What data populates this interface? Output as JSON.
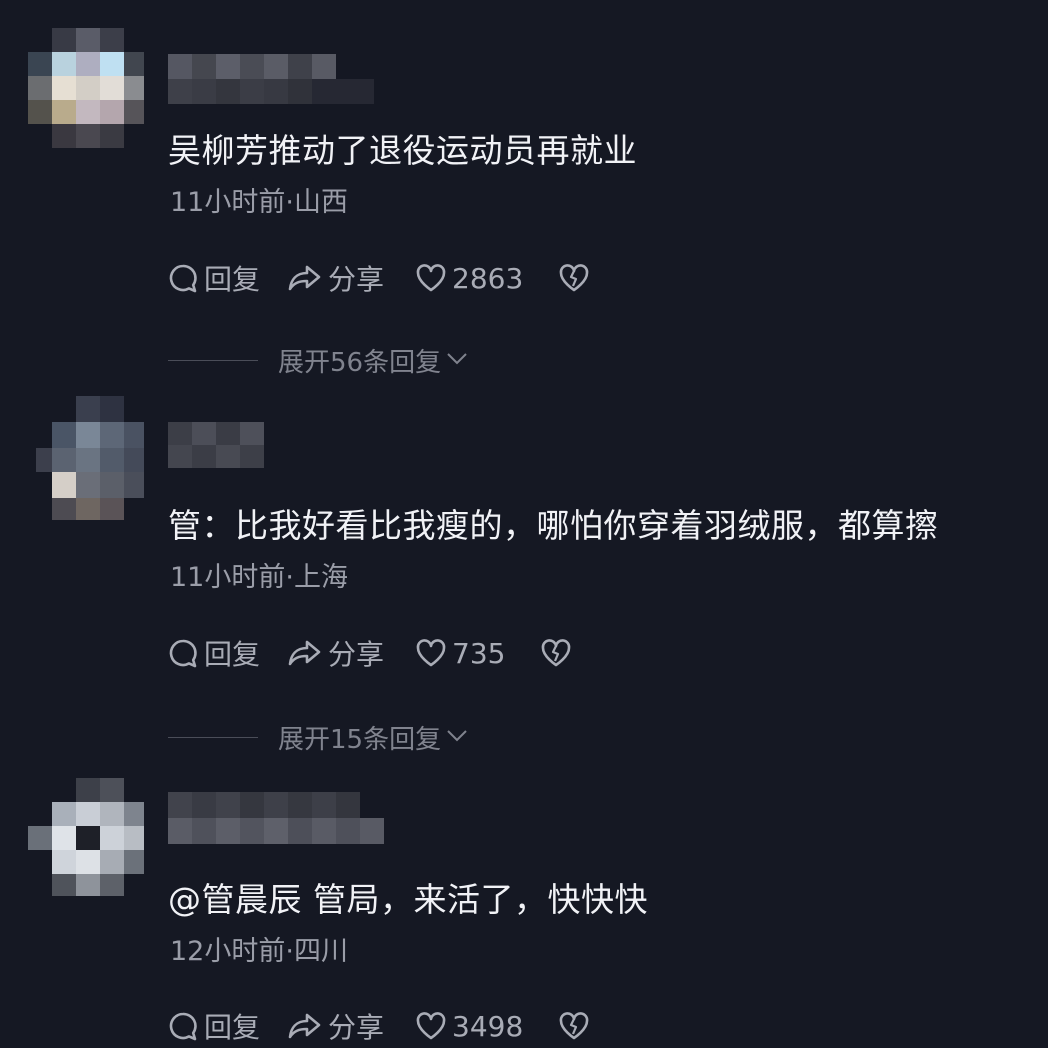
{
  "comments": [
    {
      "text": "吴柳芳推动了退役运动员再就业",
      "meta": "11小时前·山西",
      "reply_label": "回复",
      "share_label": "分享",
      "likes": "2863",
      "expand_label": "展开56条回复"
    },
    {
      "text": "管：比我好看比我瘦的，哪怕你穿着羽绒服，都算擦",
      "meta": "11小时前·上海",
      "reply_label": "回复",
      "share_label": "分享",
      "likes": "735",
      "expand_label": "展开15条回复"
    },
    {
      "text": "@管晨辰 管局，来活了，快快快",
      "meta": "12小时前·四川",
      "reply_label": "回复",
      "share_label": "分享",
      "likes": "3498"
    }
  ],
  "icons": {
    "reply": "speech-bubble-icon",
    "share": "share-arrow-icon",
    "like": "heart-icon",
    "dislike": "broken-heart-icon",
    "expand": "chevron-down-icon"
  },
  "colors": {
    "background": "#151823",
    "text_primary": "#f1f2f6",
    "text_secondary": "#9a9da8",
    "text_muted": "#80838e"
  }
}
